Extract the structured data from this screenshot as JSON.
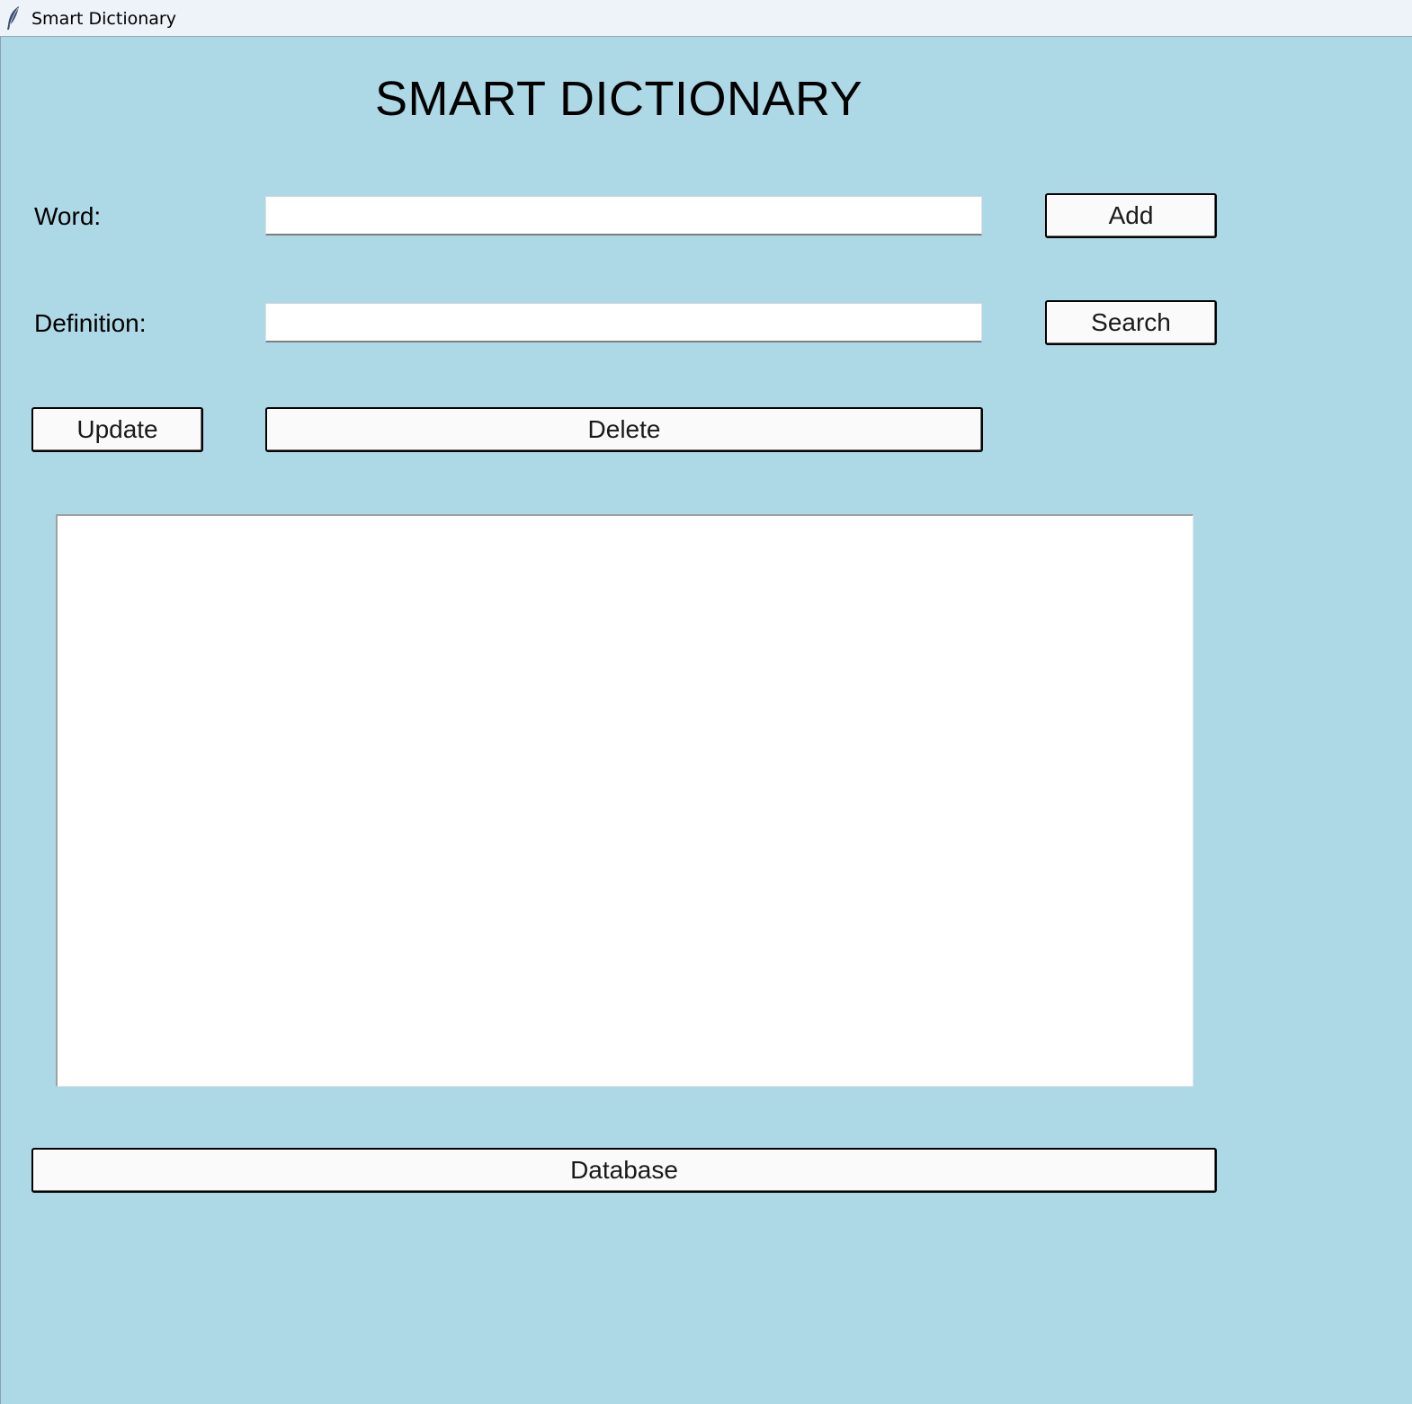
{
  "window": {
    "title": "Smart Dictionary",
    "icon": "feather-icon",
    "background_color": "#ADD8E6"
  },
  "heading": "SMART DICTIONARY",
  "form": {
    "word_label": "Word:",
    "word_value": "",
    "definition_label": "Definition:",
    "definition_value": ""
  },
  "buttons": {
    "add": "Add",
    "search": "Search",
    "update": "Update",
    "delete": "Delete",
    "database": "Database"
  },
  "results_list": {
    "items": []
  }
}
